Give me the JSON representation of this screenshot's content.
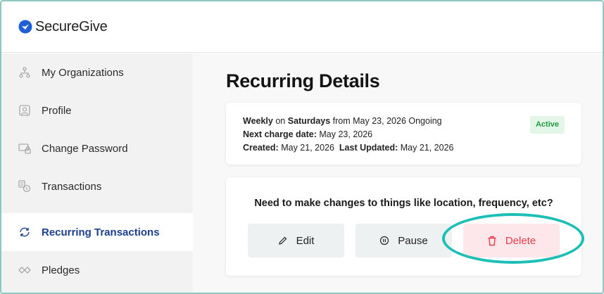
{
  "app": {
    "name": "SecureGive"
  },
  "sidebar": {
    "items": [
      {
        "label": "My Organizations",
        "icon": "org-tree-icon"
      },
      {
        "label": "Profile",
        "icon": "profile-icon"
      },
      {
        "label": "Change Password",
        "icon": "password-icon"
      },
      {
        "label": "Transactions",
        "icon": "transactions-icon"
      },
      {
        "label": "Recurring Transactions",
        "icon": "recurring-icon",
        "active": true
      },
      {
        "label": "Pledges",
        "icon": "pledge-icon"
      }
    ]
  },
  "page": {
    "title": "Recurring Details"
  },
  "details": {
    "frequency": "Weekly",
    "on_text": "on",
    "day": "Saturdays",
    "from_text": "from May 23, 2026 Ongoing",
    "next_label": "Next charge date:",
    "next_value": "May 23, 2026",
    "created_label": "Created:",
    "created_value": "May 21, 2026",
    "updated_label": "Last Updated:",
    "updated_value": "May 21, 2026",
    "status": "Active"
  },
  "actions": {
    "prompt": "Need to make changes to things like location, frequency, etc?",
    "edit_label": "Edit",
    "pause_label": "Pause",
    "delete_label": "Delete"
  },
  "colors": {
    "accent_blue": "#1b3f8c",
    "status_green": "#1f9a44",
    "delete_red": "#e43d4b",
    "highlight_teal": "#1cbfb6"
  }
}
